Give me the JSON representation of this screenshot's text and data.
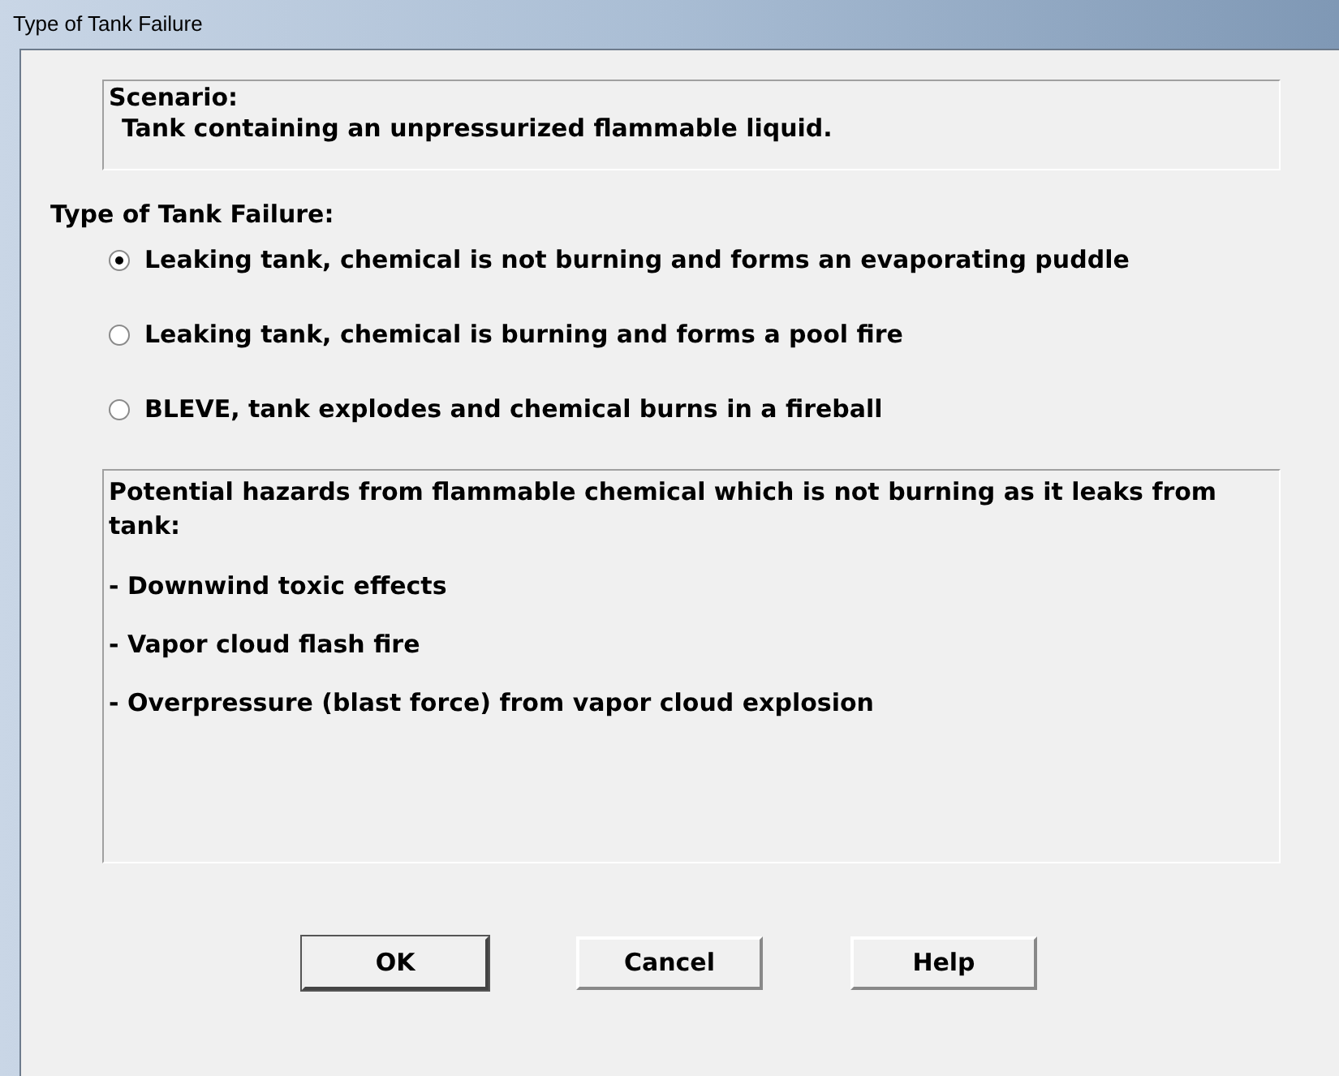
{
  "window": {
    "title": "Type of Tank Failure"
  },
  "scenario": {
    "heading": "Scenario:",
    "text": "Tank containing an unpressurized flammable liquid."
  },
  "failure_label": "Type of Tank Failure:",
  "options": [
    {
      "label": "Leaking tank, chemical is not burning and forms an evaporating puddle",
      "selected": true
    },
    {
      "label": "Leaking tank, chemical is burning and forms a pool fire",
      "selected": false
    },
    {
      "label": "BLEVE, tank explodes and chemical burns in a fireball",
      "selected": false
    }
  ],
  "hazards": {
    "intro": "Potential hazards from flammable chemical which is not burning as it leaks from tank:",
    "items": [
      "- Downwind toxic effects",
      "- Vapor cloud flash fire",
      "- Overpressure (blast force) from vapor cloud explosion"
    ]
  },
  "buttons": [
    {
      "label": "OK",
      "default": true
    },
    {
      "label": "Cancel",
      "default": false
    },
    {
      "label": "Help",
      "default": false
    }
  ]
}
